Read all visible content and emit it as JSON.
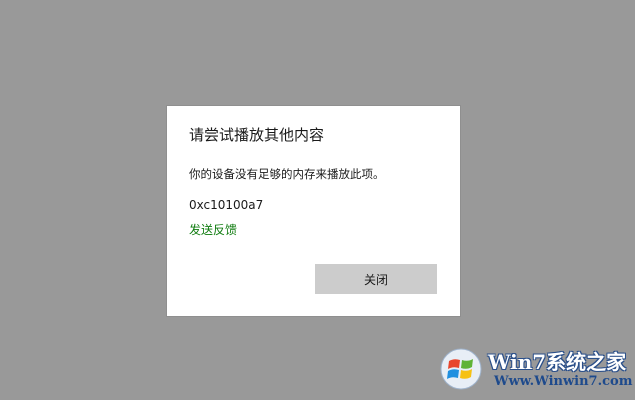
{
  "dialog": {
    "title": "请尝试播放其他内容",
    "message": "你的设备没有足够的内存来播放此项。",
    "error_code": "0xc10100a7",
    "feedback_label": "发送反馈",
    "close_label": "关闭"
  },
  "watermark": {
    "brand": "Win7系统之家",
    "url": "Www.Winwin7.com"
  },
  "colors": {
    "backdrop": "#999999",
    "link": "#107c10",
    "button": "#cccccc"
  }
}
